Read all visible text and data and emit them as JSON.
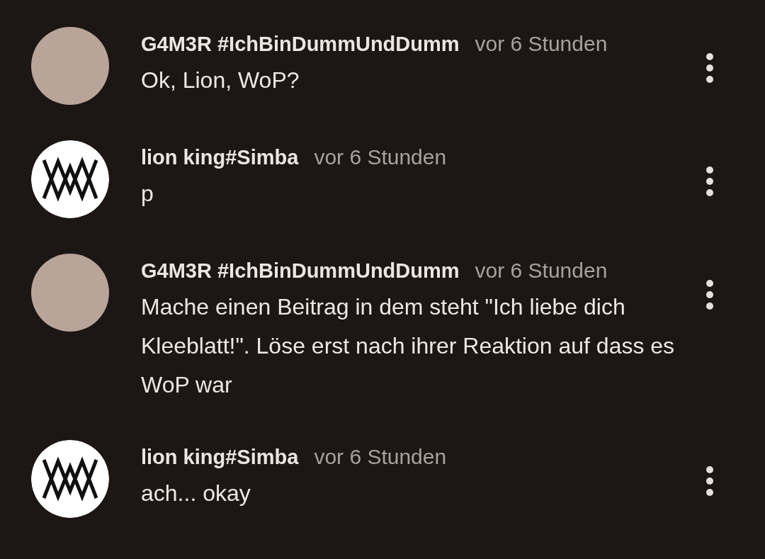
{
  "comments": [
    {
      "author": "G4M3R #IchBinDummUndDumm",
      "time": "vor 6 Stunden",
      "text": "Ok, Lion, WoP?",
      "avatar": {
        "kind": "photo"
      }
    },
    {
      "author": "lion king#Simba",
      "time": "vor 6 Stunden",
      "text": "p",
      "avatar": {
        "kind": "logo"
      }
    },
    {
      "author": "G4M3R #IchBinDummUndDumm",
      "time": "vor 6 Stunden",
      "text": "Mache einen Beitrag in dem steht \"Ich liebe dich Kleeblatt!\". Löse erst nach ihrer Reaktion auf dass es WoP war",
      "avatar": {
        "kind": "photo"
      }
    },
    {
      "author": "lion king#Simba",
      "time": "vor 6 Stunden",
      "text": "ach... okay",
      "avatar": {
        "kind": "logo"
      }
    }
  ]
}
